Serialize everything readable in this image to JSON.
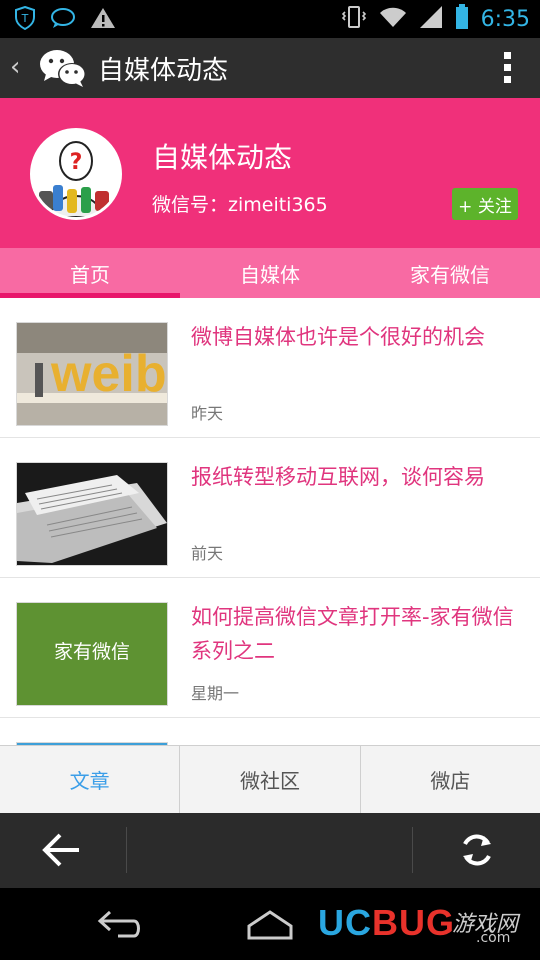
{
  "status_bar": {
    "time": "6:35",
    "icons": [
      "shield-icon",
      "chat-bubble-icon",
      "warning-icon",
      "vibrate-icon",
      "wifi-icon",
      "signal-icon",
      "battery-icon"
    ]
  },
  "title_bar": {
    "title": "自媒体动态",
    "icons": [
      "back-chevron-icon",
      "wechat-logo-icon",
      "overflow-menu-icon"
    ]
  },
  "profile": {
    "name": "自媒体动态",
    "wechat_id": "微信号：zimeiti365",
    "follow_label": "+ 关注"
  },
  "tabs": [
    {
      "label": "首页",
      "active": true
    },
    {
      "label": "自媒体",
      "active": false
    },
    {
      "label": "家有微信",
      "active": false
    }
  ],
  "articles": [
    {
      "title": "微博自媒体也许是个很好的机会",
      "time": "昨天",
      "thumb": "weibo-sign-image",
      "thumb_text": "weibo"
    },
    {
      "title": "报纸转型移动互联网，谈何容易",
      "time": "前天",
      "thumb": "newspapers-image",
      "thumb_text": ""
    },
    {
      "title": "如何提高微信文章打开率-家有微信系列之二",
      "time": "星期一",
      "thumb": "green-card-image",
      "thumb_text": "家有微信"
    }
  ],
  "bottom_menu": [
    {
      "label": "文章",
      "active": true
    },
    {
      "label": "微社区",
      "active": false
    },
    {
      "label": "微店",
      "active": false
    }
  ],
  "browser_bar": {
    "icons": [
      "back-arrow-icon",
      "refresh-icon"
    ]
  },
  "watermark": {
    "latin_1": "UC",
    "latin_2": "BUG",
    "chinese": "游戏网",
    "domain": ".com"
  },
  "colors": {
    "header_pink": "#f0307a",
    "tab_pink": "#f86aa3",
    "title_pink": "#e0357e",
    "follow_green": "#5db32b",
    "active_blue": "#3b9ee8"
  }
}
